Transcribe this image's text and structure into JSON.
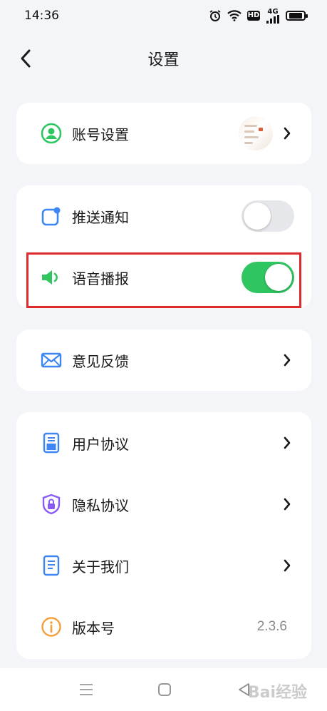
{
  "status_bar": {
    "time": "14:36",
    "icons": [
      "alarm-icon",
      "wifi-icon",
      "hd-icon",
      "signal-4g-icon",
      "battery-icon"
    ],
    "hd_label": "HD",
    "network_label": "4G"
  },
  "header": {
    "title": "设置",
    "back_icon": "chevron-left-icon"
  },
  "sections": {
    "account": {
      "label": "账号设置",
      "icon": "user-circle-icon"
    },
    "push": {
      "label": "推送通知",
      "icon": "notification-icon",
      "enabled": false
    },
    "voice": {
      "label": "语音播报",
      "icon": "speaker-icon",
      "enabled": true
    },
    "feedback": {
      "label": "意见反馈",
      "icon": "mail-icon"
    },
    "user_agreement": {
      "label": "用户协议",
      "icon": "document-icon"
    },
    "privacy": {
      "label": "隐私协议",
      "icon": "lock-shield-icon"
    },
    "about": {
      "label": "关于我们",
      "icon": "file-text-icon"
    },
    "version": {
      "label": "版本号",
      "icon": "info-icon",
      "value": "2.3.6"
    }
  },
  "nav_bar": {
    "icons": [
      "menu-icon",
      "home-square-icon",
      "back-triangle-icon"
    ]
  },
  "watermark": "Bai经验",
  "colors": {
    "green": "#2fc661",
    "blue": "#3f86f5",
    "purple": "#8a5cf6",
    "orange": "#f5a03b",
    "highlight": "#e02a2a"
  }
}
